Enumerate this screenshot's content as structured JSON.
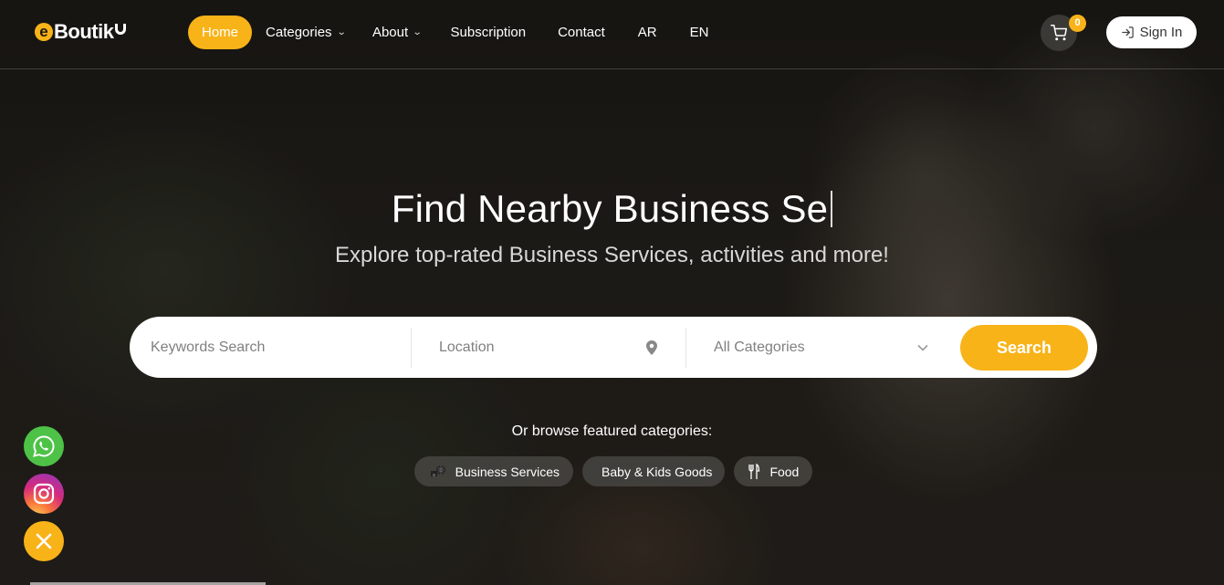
{
  "brand": {
    "logo_letter": "e",
    "logo_text": "Boutik",
    "accent": "#f8b319"
  },
  "nav": {
    "items": [
      {
        "label": "Home",
        "active": true,
        "dropdown": false
      },
      {
        "label": "Categories",
        "active": false,
        "dropdown": true
      },
      {
        "label": "About",
        "active": false,
        "dropdown": true
      },
      {
        "label": "Subscription",
        "active": false,
        "dropdown": false
      },
      {
        "label": "Contact",
        "active": false,
        "dropdown": false
      },
      {
        "label": "AR",
        "active": false,
        "dropdown": false
      },
      {
        "label": "EN",
        "active": false,
        "dropdown": false
      }
    ],
    "cart_count": "0",
    "cart_icon": "cart-icon",
    "signin_label": "Sign In",
    "signin_icon": "sign-in-icon"
  },
  "hero": {
    "title": "Find Nearby Business Se",
    "subtitle": "Explore top-rated Business Services, activities and more!"
  },
  "search": {
    "keywords_placeholder": "Keywords Search",
    "location_placeholder": "Location",
    "location_icon": "map-pin-icon",
    "category_selected": "All Categories",
    "button_label": "Search"
  },
  "featured": {
    "label": "Or browse featured categories:",
    "categories": [
      {
        "label": "Business Services",
        "icon": "business-icon"
      },
      {
        "label": "Baby & Kids Goods",
        "icon": ""
      },
      {
        "label": "Food",
        "icon": "fork-knife-icon"
      }
    ]
  },
  "floating": {
    "whatsapp_color": "#4dc247",
    "close_color": "#f8b319"
  }
}
